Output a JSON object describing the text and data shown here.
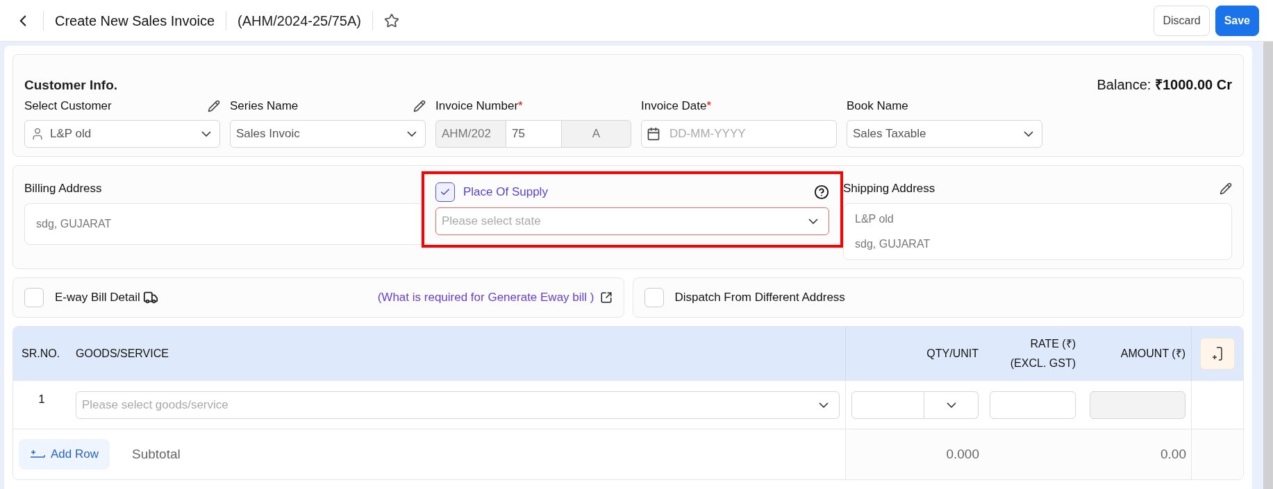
{
  "header": {
    "title": "Create New Sales Invoice",
    "invoice_code": "(AHM/2024-25/75A)",
    "starred": false,
    "buttons": [
      {
        "kind": "secondary",
        "label": "Discard"
      },
      {
        "kind": "primary",
        "label": "Save"
      }
    ]
  },
  "customer_info": {
    "title": "Customer Info.",
    "balance_label": "Balance:",
    "balance_value": "₹1000.00 Cr",
    "fields": [
      {
        "kind": "select",
        "label": "Select Customer",
        "editable": true,
        "value": "L&P old",
        "person_icon": true
      },
      {
        "kind": "select",
        "label": "Series Name",
        "editable": true,
        "value": "Sales Invoic",
        "person_icon": false
      },
      {
        "kind": "number",
        "label": "Invoice Number",
        "required_mark": "*",
        "editable": false,
        "parts": [
          "AHM/202",
          "75",
          "A"
        ]
      },
      {
        "kind": "date",
        "label": "Invoice Date",
        "required_mark": "*",
        "editable": false,
        "placeholder": "DD-MM-YYYY"
      },
      {
        "kind": "select",
        "label": "Book Name",
        "editable": false,
        "value": "Sales Taxable",
        "person_icon": false
      }
    ]
  },
  "billing_address": {
    "label": "Billing Address",
    "lines": [
      "sdg, GUJARAT"
    ]
  },
  "place_of_supply": {
    "label": "Place Of Supply",
    "checked": true,
    "placeholder": "Please select state",
    "highlighted": true
  },
  "shipping_address": {
    "label": "Shipping Address",
    "lines": [
      "L&P old",
      "sdg, GUJARAT"
    ]
  },
  "options": [
    {
      "label": "E-way Bill Detail",
      "checked": false,
      "truck_icon": true,
      "link": "(What is required for Generate Eway bill )"
    },
    {
      "label": "Dispatch From Different Address",
      "checked": false,
      "truck_icon": false
    }
  ],
  "table": {
    "columns": [
      "SR.NO.",
      "GOODS/SERVICE",
      "QTY/UNIT",
      "RATE (₹) (EXCL. GST)",
      "AMOUNT (₹)"
    ],
    "rows": [
      {
        "sr": "1",
        "goods_placeholder": "Please select goods/service"
      }
    ],
    "add_row": "Add Row",
    "subtotal_label": "Subtotal",
    "subtotal_qty": "0.000",
    "subtotal_amount": "0.00"
  }
}
